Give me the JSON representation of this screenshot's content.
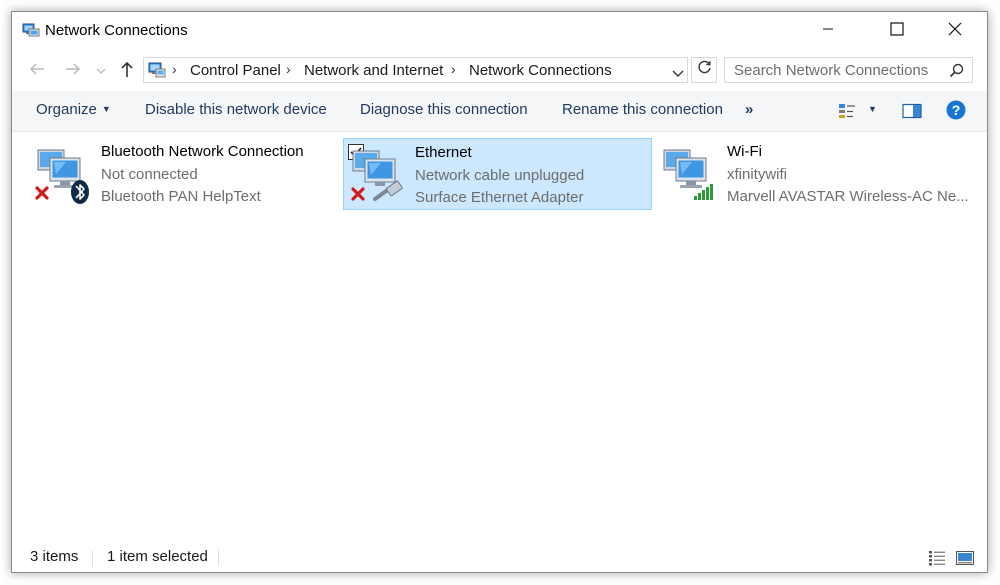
{
  "window": {
    "title": "Network Connections",
    "title_icon": "network-connections-icon"
  },
  "titlebar_buttons": {
    "minimize": "minimize-icon",
    "maximize": "maximize-icon",
    "close": "close-icon"
  },
  "navigation": {
    "back": "back-arrow-icon",
    "forward": "forward-arrow-icon",
    "recent": "chevron-down-icon",
    "up": "up-arrow-icon"
  },
  "address_bar": {
    "icon": "control-panel-icon",
    "crumbs": [
      "Control Panel",
      "Network and Internet",
      "Network Connections"
    ],
    "separator": "›",
    "dropdown_icon": "chevron-down-icon",
    "refresh_icon": "refresh-icon"
  },
  "search": {
    "placeholder": "Search Network Connections",
    "icon": "search-icon"
  },
  "command_bar": {
    "organize": "Organize",
    "disable": "Disable this network device",
    "diagnose": "Diagnose this connection",
    "rename": "Rename this connection",
    "more": "»",
    "view_icon": "change-view-icon",
    "preview_icon": "preview-pane-icon",
    "help_icon": "help-icon"
  },
  "connections": [
    {
      "name": "Bluetooth Network Connection",
      "status": "Not connected",
      "device": "Bluetooth PAN HelpText",
      "icon": "bluetooth-network-icon",
      "selected": false
    },
    {
      "name": "Ethernet",
      "status": "Network cable unplugged",
      "device": "Surface Ethernet Adapter",
      "icon": "ethernet-network-icon",
      "selected": true
    },
    {
      "name": "Wi-Fi",
      "status": "xfinitywifi",
      "device": "Marvell AVASTAR Wireless-AC Ne...",
      "icon": "wifi-network-icon",
      "selected": false
    }
  ],
  "status_bar": {
    "items_count": "3 items",
    "selection": "1 item selected",
    "details_view_icon": "details-view-icon",
    "large_icons_view_icon": "large-icons-view-icon"
  },
  "colors": {
    "selection_bg": "#cce8ff",
    "selection_border": "#99d1ff",
    "command_text": "#1e395b",
    "help_blue": "#1976d2",
    "error_red": "#d11b1b",
    "signal_green": "#2e9b3a"
  }
}
